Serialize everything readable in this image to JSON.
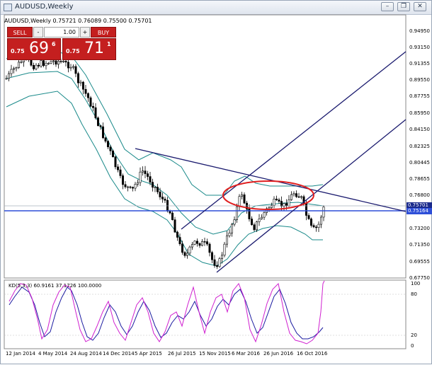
{
  "window": {
    "title": "AUDUSD,Weekly",
    "controls": [
      "minimize",
      "restore",
      "close"
    ]
  },
  "chart_header": {
    "text": "AUDUSD,Weekly  0.75721 0.76089 0.75500 0.75701"
  },
  "trade_panel": {
    "sell_label": "SELL",
    "buy_label": "BUY",
    "lot_value": "1.00",
    "decrease_label": "-",
    "increase_label": "+",
    "sell_price": {
      "prefix": "0.75",
      "big": "69",
      "sup": "6"
    },
    "buy_price": {
      "prefix": "0.75",
      "big": "71",
      "sup": "1"
    }
  },
  "price_axis": {
    "labels": [
      "0.94950",
      "0.93150",
      "0.91355",
      "0.89550",
      "0.87755",
      "0.85950",
      "0.84150",
      "0.82325",
      "0.80445",
      "0.78655",
      "0.76800",
      "0.75701",
      "0.75164",
      "0.73200",
      "0.71350",
      "0.69555",
      "0.67750"
    ]
  },
  "price_badges": {
    "current": "0.75701",
    "line": "0.75164",
    "current_color": "#1a2a8c",
    "line_color": "#2e4fd8"
  },
  "date_axis": {
    "labels": [
      "12 Jan 2014",
      "4 May 2014",
      "24 Aug 2014",
      "14 Dec 2014",
      "5 Apr 2015",
      "26 Jul 2015",
      "15 Nov 2015",
      "6 Mar 2016",
      "26 Jun 2016",
      "16 Oct 2016"
    ]
  },
  "indicator": {
    "legend": "KD(5,3,3) 60.9161 37.1726 100.0000",
    "levels": [
      "100",
      "80",
      "20",
      "0"
    ],
    "k_color": "#1a1aa0",
    "d_color": "#d020d0"
  },
  "colors": {
    "trendline": "#1a1a6e",
    "bollinger": "#1a8a8a",
    "horizontal_line": "#2e4fd8",
    "ellipse": "#e02020",
    "sell_buy_red": "#c41f1f"
  },
  "chart_data": {
    "type": "candlestick",
    "symbol": "AUDUSD",
    "timeframe": "Weekly",
    "last": {
      "open": 0.75721,
      "high": 0.76089,
      "low": 0.755,
      "close": 0.75701
    },
    "ylim": [
      0.6775,
      0.9495
    ],
    "horizontal_lines": [
      0.75164
    ],
    "indicator": {
      "name": "KD(5,3,3)",
      "k": 60.9161,
      "d": 37.1726,
      "extra": 100.0,
      "levels": [
        100,
        80,
        20,
        0
      ]
    }
  }
}
